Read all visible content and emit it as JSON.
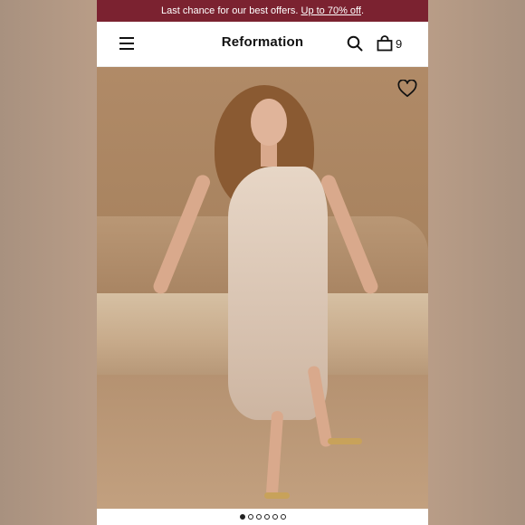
{
  "promo": {
    "text": "Last chance for our best offers.",
    "link": "Up to 70% off",
    "suffix": "."
  },
  "header": {
    "brand": "Reformation",
    "menu_icon": "hamburger-menu-icon",
    "search_icon": "search-icon",
    "bag_icon": "shopping-bag-icon",
    "bag_count": "9"
  },
  "product": {
    "favorite_icon": "heart-outline-icon"
  },
  "carousel": {
    "total_slides": 6,
    "active_index": 0
  },
  "colors": {
    "promo_bg": "#7b2230",
    "text": "#111111"
  }
}
